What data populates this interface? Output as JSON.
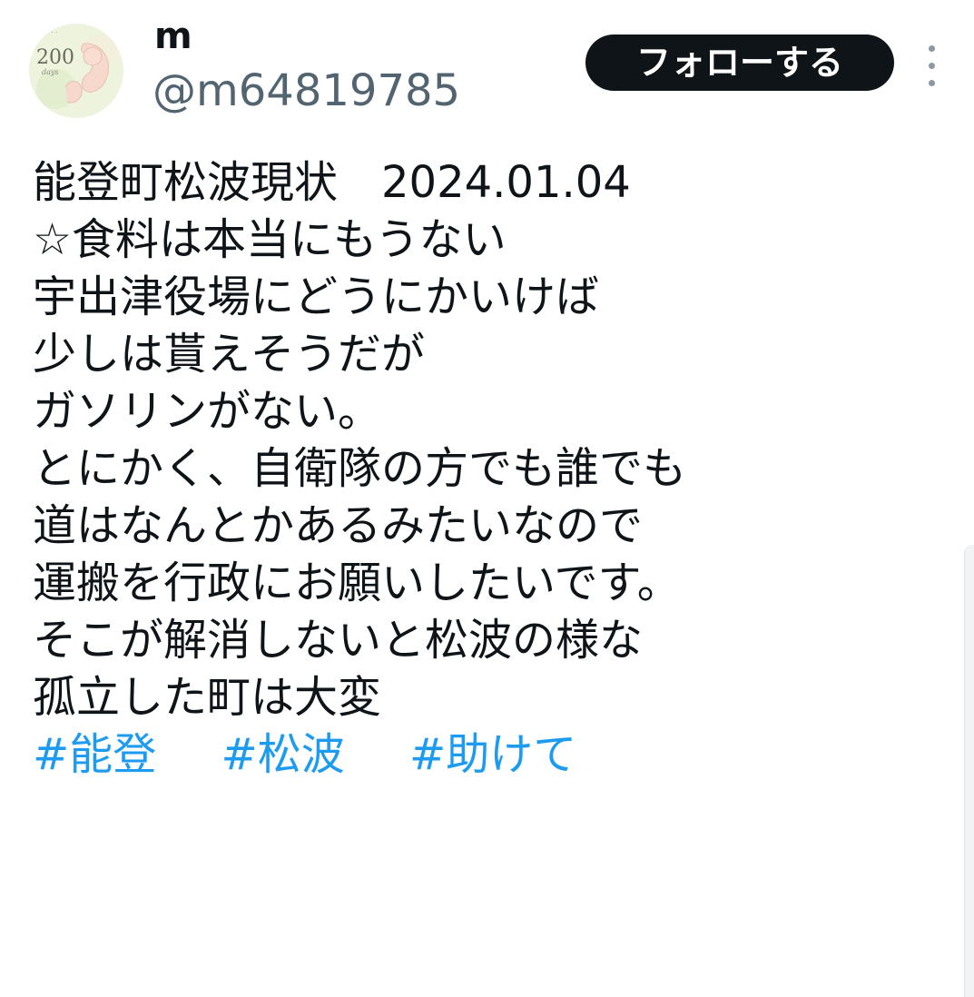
{
  "author": {
    "display_name": "m",
    "handle": "@m64819785",
    "avatar_text": "200",
    "avatar_subtext": "days"
  },
  "actions": {
    "follow_label": "フォローする",
    "more_icon": "more-vertical-icon"
  },
  "tweet": {
    "lines": [
      "能登町松波現状　2024.01.04",
      "☆食料は本当にもうない",
      "宇出津役場にどうにかいけば",
      "少しは貰えそうだが",
      "ガソリンがない。",
      "とにかく、自衛隊の方でも誰でも",
      "道はなんとかあるみたいなので",
      "運搬を行政にお願いしたいです。",
      "そこが解消しないと松波の様な",
      "孤立した町は大変"
    ],
    "hashtags": [
      "#能登",
      "#松波",
      "#助けて"
    ]
  },
  "colors": {
    "text": "#0f1419",
    "secondary": "#536471",
    "link": "#1d9bf0",
    "button_bg": "#0f1419"
  }
}
